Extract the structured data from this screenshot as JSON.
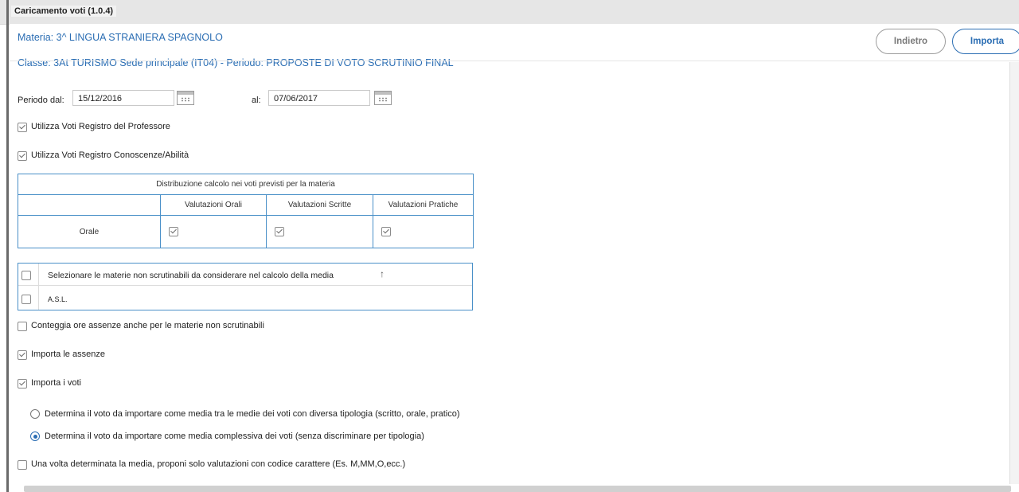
{
  "window": {
    "title": "Caricamento voti (1.0.4)"
  },
  "header": {
    "materia": "Materia: 3^ LINGUA STRANIERA SPAGNOLO",
    "classe": "Classe: 3At TURISMO Sede principale (IT04) - Periodo: PROPOSTE DI VOTO SCRUTINIO FINAL"
  },
  "buttons": {
    "back": "Indietro",
    "import": "Importa"
  },
  "period": {
    "from_label": "Periodo dal:",
    "from_value": "15/12/2016",
    "to_label": "al:",
    "to_value": "07/06/2017"
  },
  "options": {
    "registro_professore": {
      "label": "Utilizza Voti Registro del Professore",
      "checked": true
    },
    "registro_conoscenze": {
      "label": "Utilizza Voti Registro Conoscenze/Abilità",
      "checked": true
    }
  },
  "distribution": {
    "title": "Distribuzione calcolo nei voti previsti per la materia",
    "columns": [
      "Valutazioni Orali",
      "Valutazioni Scritte",
      "Valutazioni Pratiche"
    ],
    "row_label": "Orale",
    "checks": [
      true,
      true,
      true
    ]
  },
  "subjects": {
    "header_label": "Selezionare le materie non scrutinabili da considerare nel calcolo della media",
    "sort_icon": "up-arrow-icon",
    "items": [
      "A.S.L."
    ]
  },
  "more": {
    "conteggia": {
      "label": "Conteggia ore assenze anche per le materie non scrutinabili",
      "checked": false
    },
    "importa_assenze": {
      "label": "Importa le assenze",
      "checked": true
    },
    "importa_voti": {
      "label": "Importa i voti",
      "checked": true
    },
    "radio_medie": {
      "label": "Determina il voto da importare come media tra le medie dei voti con diversa tipologia (scritto, orale, pratico)",
      "selected": false
    },
    "radio_complessiva": {
      "label": "Determina il voto da importare come media complessiva dei voti (senza discriminare per tipologia)",
      "selected": true
    },
    "codice_carattere": {
      "label": "Una volta determinata la media, proponi solo valutazioni con codice carattere (Es. M,MM,O,ecc.)",
      "checked": false
    }
  },
  "colors": {
    "accent": "#2a6db3",
    "table_border": "#4a90c8"
  }
}
